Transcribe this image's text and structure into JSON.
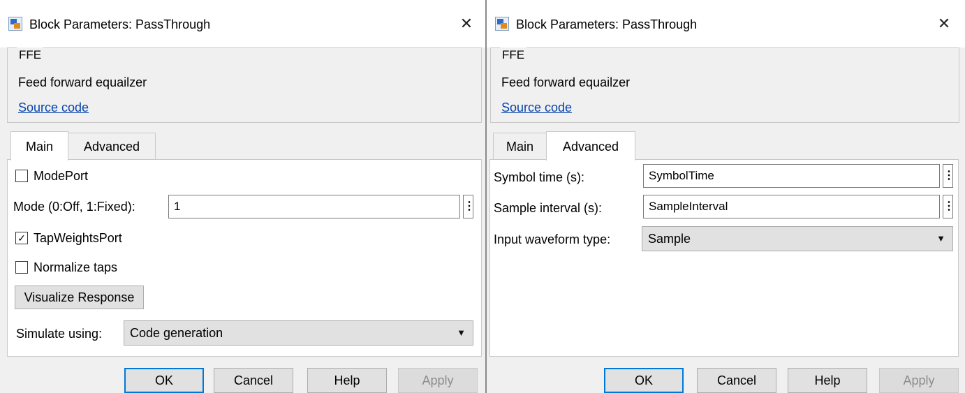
{
  "left_dialog": {
    "title": "Block Parameters: PassThrough",
    "close_glyph": "✕",
    "group_title": "FFE",
    "description": "Feed forward equailzer",
    "source_link": "Source code",
    "tabs": [
      {
        "label": "Main",
        "active": true
      },
      {
        "label": "Advanced",
        "active": false
      }
    ],
    "main_tab": {
      "mode_port": {
        "label": "ModePort",
        "checked": false
      },
      "mode": {
        "label": "Mode (0:Off, 1:Fixed):",
        "value": "1"
      },
      "tap_weights_port": {
        "label": "TapWeightsPort",
        "checked": true
      },
      "normalize_taps": {
        "label": "Normalize taps",
        "checked": false
      },
      "visualize_button": "Visualize Response",
      "simulate_using": {
        "label": "Simulate using:",
        "value": "Code generation"
      }
    },
    "buttons": {
      "ok": "OK",
      "cancel": "Cancel",
      "help": "Help",
      "apply": "Apply"
    }
  },
  "right_dialog": {
    "title": "Block Parameters: PassThrough",
    "close_glyph": "✕",
    "group_title": "FFE",
    "description": "Feed forward equailzer",
    "source_link": "Source code",
    "tabs": [
      {
        "label": "Main",
        "active": false
      },
      {
        "label": "Advanced",
        "active": true
      }
    ],
    "advanced_tab": {
      "symbol_time": {
        "label": "Symbol time (s):",
        "value": "SymbolTime"
      },
      "sample_interval": {
        "label": "Sample interval (s):",
        "value": "SampleInterval"
      },
      "input_waveform_type": {
        "label": "Input waveform type:",
        "value": "Sample"
      }
    },
    "buttons": {
      "ok": "OK",
      "cancel": "Cancel",
      "help": "Help",
      "apply": "Apply"
    }
  },
  "icons": {
    "app_icon": "simulink-block-icon",
    "close": "close-icon",
    "more_options": "vertical-ellipsis-icon",
    "dropdown": "caret-down-icon",
    "check": "✓"
  },
  "colors": {
    "dialog_bg": "#f0f0f0",
    "link": "#0645ad",
    "default_button_border": "#0078d7"
  }
}
